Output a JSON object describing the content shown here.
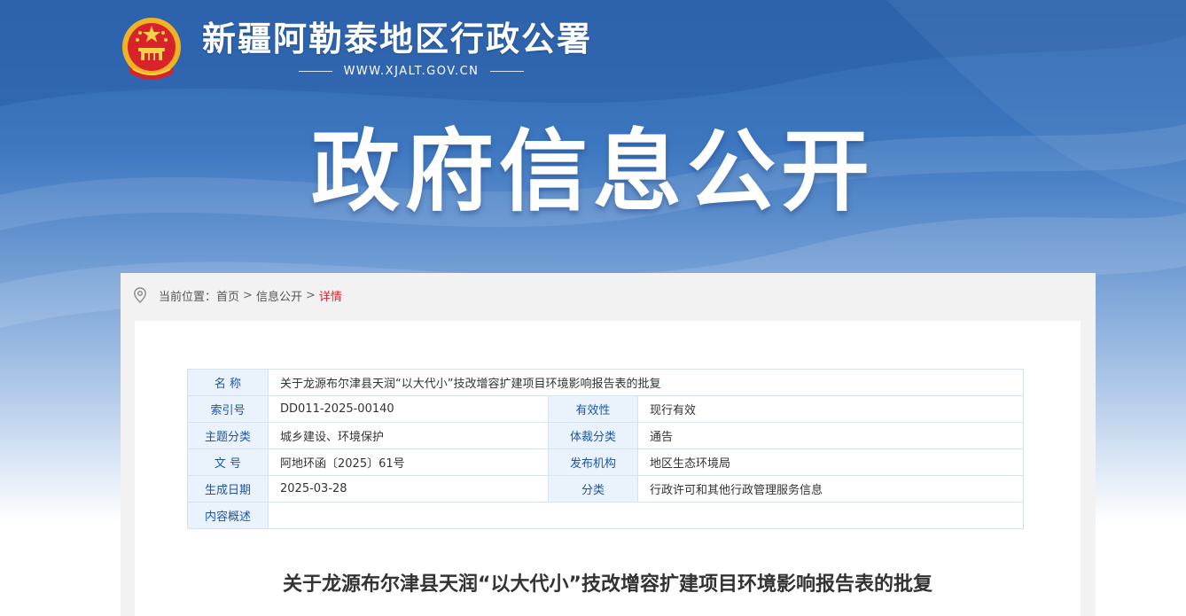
{
  "header": {
    "site_title": "新疆阿勒泰地区行政公署",
    "site_url": "WWW.XJALT.GOV.CN",
    "banner_title": "政府信息公开",
    "emblem_icon": "national-emblem-icon"
  },
  "breadcrumb": {
    "prefix": "当前位置：",
    "items": [
      "首页",
      "信息公开"
    ],
    "current": "详情",
    "separator": ">",
    "current_color": "#d8232a"
  },
  "meta": {
    "name_label": "名 称",
    "name_value": "关于龙源布尔津县天润“以大代小”技改增容扩建项目环境影响报告表的批复",
    "rows": [
      {
        "k1": "索引号",
        "v1": "DD011-2025-00140",
        "k2": "有效性",
        "v2": "现行有效"
      },
      {
        "k1": "主题分类",
        "v1": "城乡建设、环境保护",
        "k2": "体裁分类",
        "v2": "通告"
      },
      {
        "k1": "文 号",
        "v1": "阿地环函〔2025〕61号",
        "k2": "发布机构",
        "v2": "地区生态环境局"
      },
      {
        "k1": "生成日期",
        "v1": "2025-03-28",
        "k2": "分类",
        "v2": "行政许可和其他行政管理服务信息"
      }
    ],
    "summary_label": "内容概述",
    "summary_value": ""
  },
  "article": {
    "title": "关于龙源布尔津县天润“以大代小”技改增容扩建项目环境影响报告表的批复"
  },
  "colors": {
    "banner_blue": "#3d77c0",
    "label_blue": "#1a56a6",
    "label_bg": "#eaf3fc"
  }
}
